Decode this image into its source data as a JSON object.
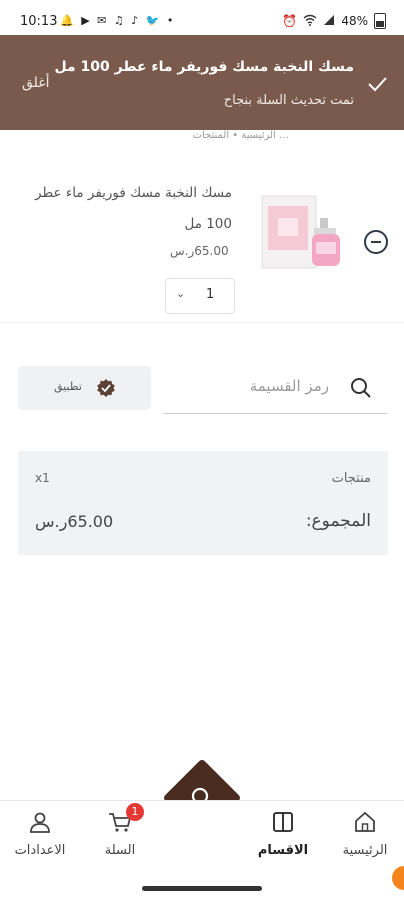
{
  "status_bar": {
    "time": "10:13",
    "left_icons": "🔔 ▶ ✉ ♫ ♪ 🐦 •",
    "battery": "48%"
  },
  "toast": {
    "title": "مسك النخبة مسك فوريفر ماء عطر 100 مل",
    "subtitle": "تمت تحديث السلة بنجاح",
    "close_label": "أغلق"
  },
  "breadcrumb_peek": "… الرئيسية • المنتجات",
  "cart_item": {
    "title": "مسك النخبة مسك فوريفر ماء عطر 100 مل",
    "price": "65.00ر.س",
    "quantity": "1"
  },
  "coupon": {
    "placeholder": "رمز القسيمة",
    "apply_label": "تطبيق"
  },
  "summary": {
    "products_label": "منتجات",
    "count": "x1",
    "total_label": "المجموع:",
    "total_value": "65.00ر.س"
  },
  "nav": {
    "home": "الرئيسية",
    "categories": "الاقسام",
    "cart": "السلة",
    "cart_badge": "1",
    "settings": "الاعدادات"
  },
  "colors": {
    "toast_bg": "#7a5a4c",
    "fab_bg": "#4a2b1f",
    "badge": "#e53935"
  }
}
